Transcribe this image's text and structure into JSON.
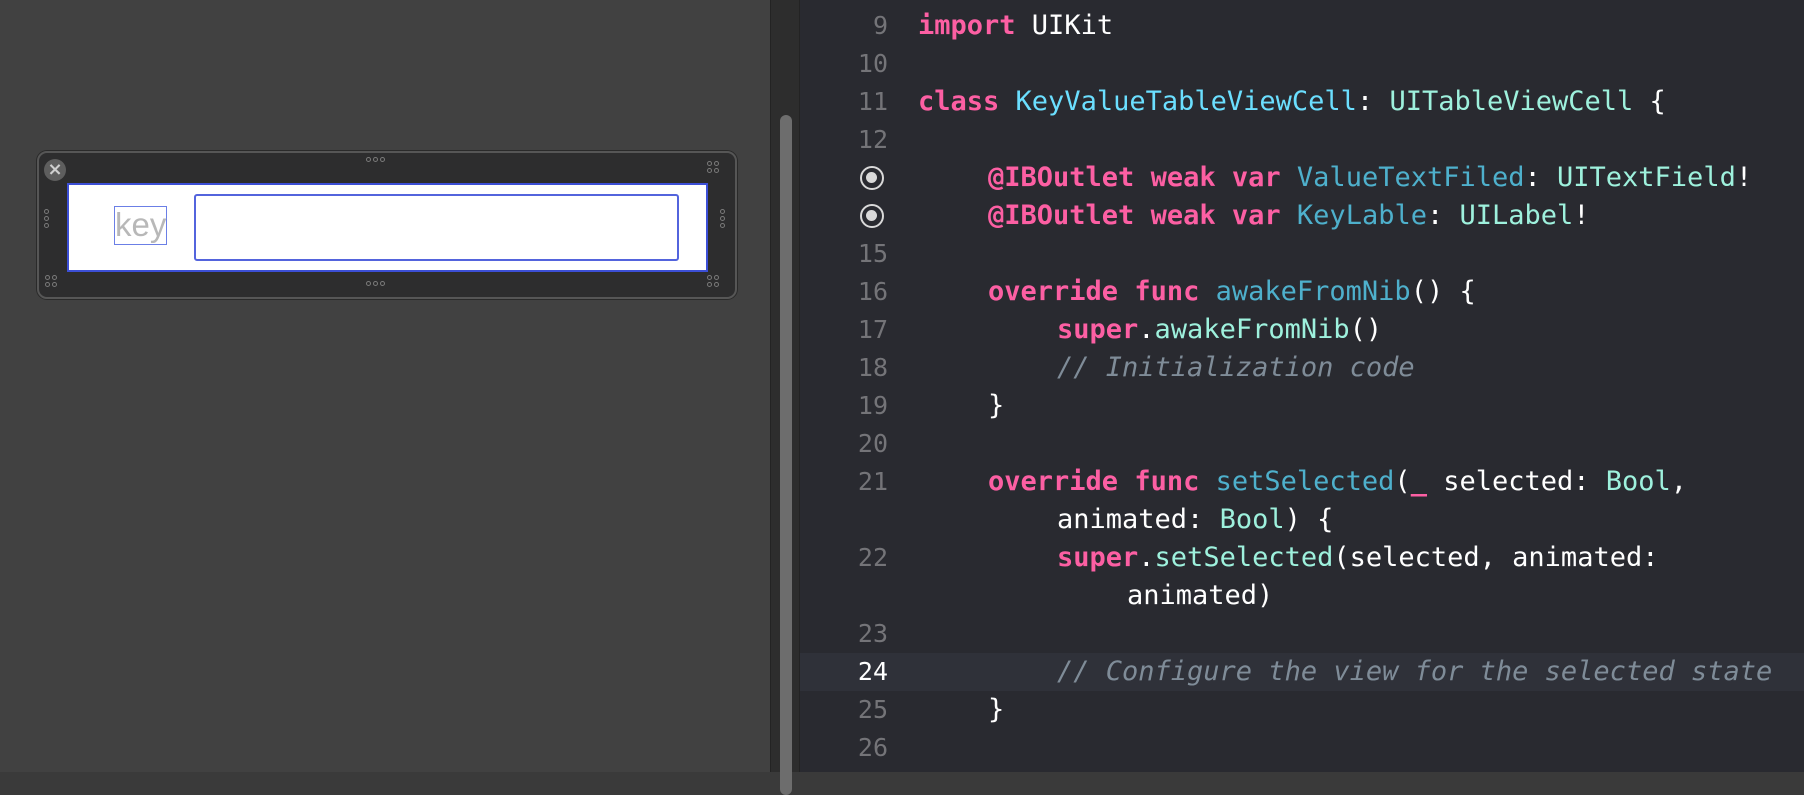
{
  "ib": {
    "close_glyph": "×",
    "key_label": "key",
    "value_field_text": ""
  },
  "editor": {
    "lines": [
      {
        "n": "9",
        "tokens": [
          {
            "c": "kw",
            "t": "import"
          },
          {
            "c": "",
            "t": " UIKit"
          }
        ]
      },
      {
        "n": "10",
        "tokens": []
      },
      {
        "n": "11",
        "tokens": [
          {
            "c": "kw",
            "t": "class"
          },
          {
            "c": "",
            "t": " "
          },
          {
            "c": "ty",
            "t": "KeyValueTableViewCell"
          },
          {
            "c": "",
            "t": ": "
          },
          {
            "c": "ty3",
            "t": "UITableViewCell"
          },
          {
            "c": "",
            "t": " {"
          }
        ]
      },
      {
        "n": "12",
        "tokens": []
      },
      {
        "n": "",
        "outlet": true,
        "tokens": [
          {
            "c": "kw",
            "t": "@IBOutlet"
          },
          {
            "c": "",
            "t": " "
          },
          {
            "c": "kw",
            "t": "weak"
          },
          {
            "c": "",
            "t": " "
          },
          {
            "c": "kw",
            "t": "var"
          },
          {
            "c": "",
            "t": " "
          },
          {
            "c": "fn2",
            "t": "ValueTextFiled"
          },
          {
            "c": "",
            "t": ": "
          },
          {
            "c": "ty3",
            "t": "UITextField"
          },
          {
            "c": "",
            "t": "!"
          }
        ]
      },
      {
        "n": "",
        "outlet": true,
        "tokens": [
          {
            "c": "kw",
            "t": "@IBOutlet"
          },
          {
            "c": "",
            "t": " "
          },
          {
            "c": "kw",
            "t": "weak"
          },
          {
            "c": "",
            "t": " "
          },
          {
            "c": "kw",
            "t": "var"
          },
          {
            "c": "",
            "t": " "
          },
          {
            "c": "fn2",
            "t": "KeyLable"
          },
          {
            "c": "",
            "t": ": "
          },
          {
            "c": "ty3",
            "t": "UILabel"
          },
          {
            "c": "",
            "t": "!"
          }
        ]
      },
      {
        "n": "15",
        "tokens": []
      },
      {
        "n": "16",
        "tokens": [
          {
            "c": "kw",
            "t": "override"
          },
          {
            "c": "",
            "t": " "
          },
          {
            "c": "kw",
            "t": "func"
          },
          {
            "c": "",
            "t": " "
          },
          {
            "c": "fn2",
            "t": "awakeFromNib"
          },
          {
            "c": "",
            "t": "() {"
          }
        ]
      },
      {
        "n": "17",
        "tokens": [
          {
            "c": "kw",
            "t": "super"
          },
          {
            "c": "",
            "t": "."
          },
          {
            "c": "ty3",
            "t": "awakeFromNib"
          },
          {
            "c": "",
            "t": "()"
          }
        ]
      },
      {
        "n": "18",
        "tokens": [
          {
            "c": "cm",
            "t": "// Initialization code"
          }
        ]
      },
      {
        "n": "19",
        "tokens": [
          {
            "c": "",
            "t": "}"
          }
        ]
      },
      {
        "n": "20",
        "tokens": []
      },
      {
        "n": "21",
        "tokens": [
          {
            "c": "kw",
            "t": "override"
          },
          {
            "c": "",
            "t": " "
          },
          {
            "c": "kw",
            "t": "func"
          },
          {
            "c": "",
            "t": " "
          },
          {
            "c": "fn2",
            "t": "setSelected"
          },
          {
            "c": "",
            "t": "("
          },
          {
            "c": "kw",
            "t": "_"
          },
          {
            "c": "",
            "t": " selected: "
          },
          {
            "c": "ty3",
            "t": "Bool"
          },
          {
            "c": "",
            "t": ","
          }
        ]
      },
      {
        "n": "",
        "tokens": [
          {
            "c": "",
            "t": "animated: "
          },
          {
            "c": "ty3",
            "t": "Bool"
          },
          {
            "c": "",
            "t": ") {"
          }
        ]
      },
      {
        "n": "22",
        "tokens": [
          {
            "c": "kw",
            "t": "super"
          },
          {
            "c": "",
            "t": "."
          },
          {
            "c": "ty3",
            "t": "setSelected"
          },
          {
            "c": "",
            "t": "(selected, animated:"
          }
        ]
      },
      {
        "n": "",
        "tokens": [
          {
            "c": "",
            "t": "animated)"
          }
        ]
      },
      {
        "n": "23",
        "tokens": []
      },
      {
        "n": "24",
        "current": true,
        "tokens": [
          {
            "c": "cm",
            "t": "// Configure the view for the selected state"
          }
        ]
      },
      {
        "n": "25",
        "tokens": [
          {
            "c": "",
            "t": "}"
          }
        ]
      },
      {
        "n": "26",
        "tokens": []
      }
    ]
  }
}
